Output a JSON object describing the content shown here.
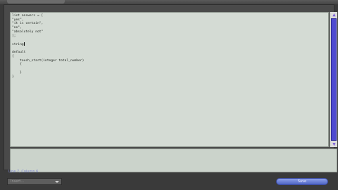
{
  "code": {
    "lines": [
      "list answers = [",
      "\"yes\",",
      "\"it is certain\",",
      "\"no\",",
      "\"absolutely not\"",
      "];",
      "",
      "string",
      "",
      "default",
      "{",
      "    touch_start(integer total_number)",
      "    {",
      "",
      "    }",
      "}"
    ]
  },
  "status": {
    "text": "Line 7, Column 6"
  },
  "dropdown": {
    "label": "Insert..."
  },
  "buttons": {
    "save": "Save"
  },
  "colors": {
    "editor_bg": "#d4dbd4",
    "scroll_thumb": "#4e4ad0",
    "accent": "#7f86cf"
  },
  "icons": {
    "scroll_up": "arrow-up-icon",
    "scroll_down": "arrow-down-icon",
    "dropdown": "chevron-down-icon"
  }
}
